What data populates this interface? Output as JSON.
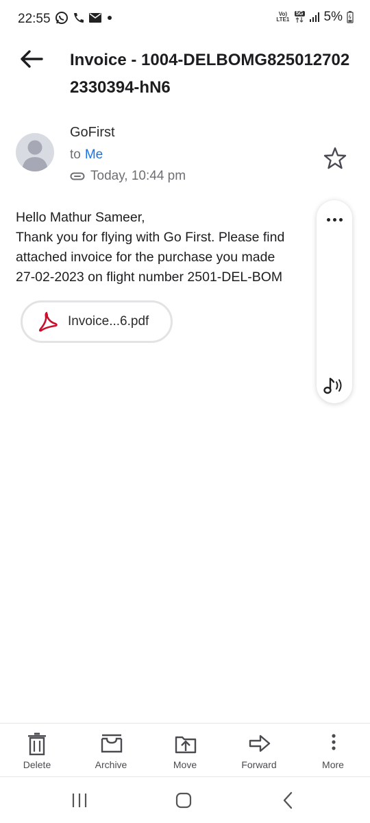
{
  "status_bar": {
    "time": "22:55",
    "volte_label": "Vo) LTE1",
    "network_label": "5G",
    "battery": "5%",
    "icons": [
      "whatsapp-icon",
      "phone-icon",
      "mail-icon",
      "dot-icon",
      "signal-icon",
      "battery-icon"
    ]
  },
  "header": {
    "subject": "Invoice - 1004-DELBOMG8250127022330394-hN6"
  },
  "sender": {
    "name": "GoFirst",
    "to_prefix": "to",
    "to_name": "Me",
    "date": "Today, 10:44 pm"
  },
  "email_body": {
    "lines": [
      "Hello Mathur Sameer,",
      "Thank you for flying with Go First. Please find",
      "attached invoice for the purchase you made",
      "27-02-2023 on flight number 2501-DEL-BOM"
    ]
  },
  "attachment": {
    "name": "Invoice...6.pdf",
    "accent": "#c8102e"
  },
  "toolbar": {
    "items": [
      {
        "label": "Delete"
      },
      {
        "label": "Archive"
      },
      {
        "label": "Move"
      },
      {
        "label": "Forward"
      },
      {
        "label": "More"
      }
    ]
  },
  "colors": {
    "link": "#1a73e8",
    "text": "#1d1d1f",
    "muted": "#6e6e73"
  }
}
